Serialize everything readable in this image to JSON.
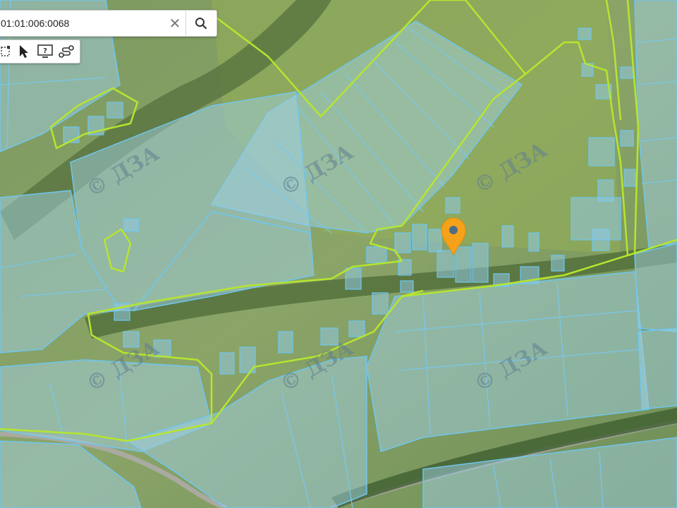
{
  "search": {
    "value": "01:01:006:0068"
  },
  "toolbar": {
    "tools": [
      {
        "name": "measure-area-tool",
        "icon": "area-icon"
      },
      {
        "name": "select-tool",
        "icon": "cursor-icon"
      },
      {
        "name": "info-tool",
        "icon": "monitor-help-icon"
      },
      {
        "name": "route-tool",
        "icon": "route-icon"
      }
    ]
  },
  "map": {
    "watermark": "© ДЗА",
    "marker_color": "#f5a21a",
    "parcel_color": "#6fc6ee",
    "boundary_color": "#b6e52f"
  }
}
